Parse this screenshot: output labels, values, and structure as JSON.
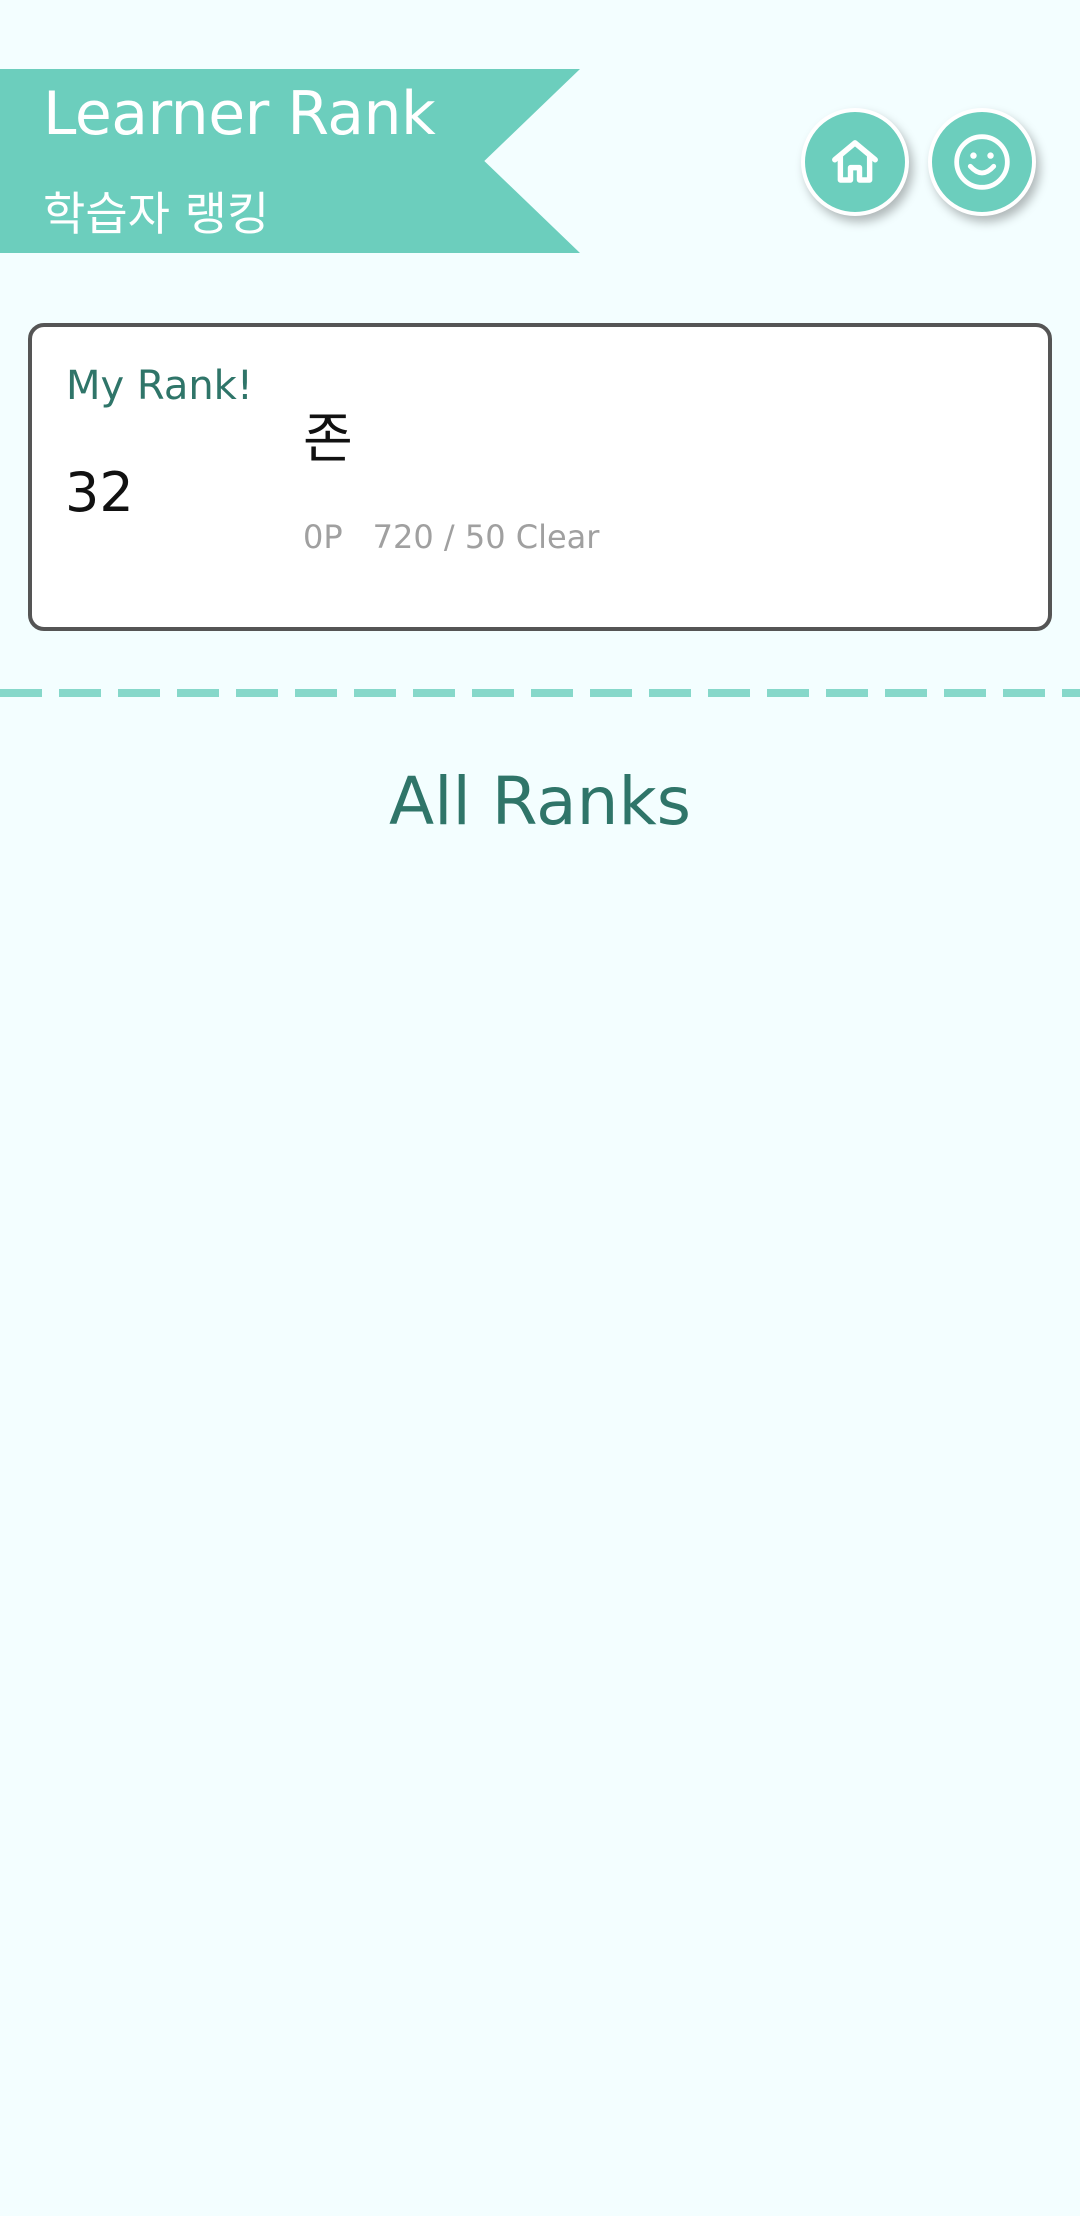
{
  "header": {
    "title": "Learner Rank",
    "subtitle": "학습자 랭킹",
    "accent_color": "#6CCEBD",
    "home_button": {
      "icon": "home-icon"
    },
    "profile_button": {
      "icon": "smiley-face-icon"
    }
  },
  "my_rank": {
    "label": "My Rank!",
    "rank": "32",
    "name": "존",
    "points": "0P",
    "progress": "720 / 50 Clear"
  },
  "all_ranks": {
    "title": "All Ranks",
    "items": []
  }
}
